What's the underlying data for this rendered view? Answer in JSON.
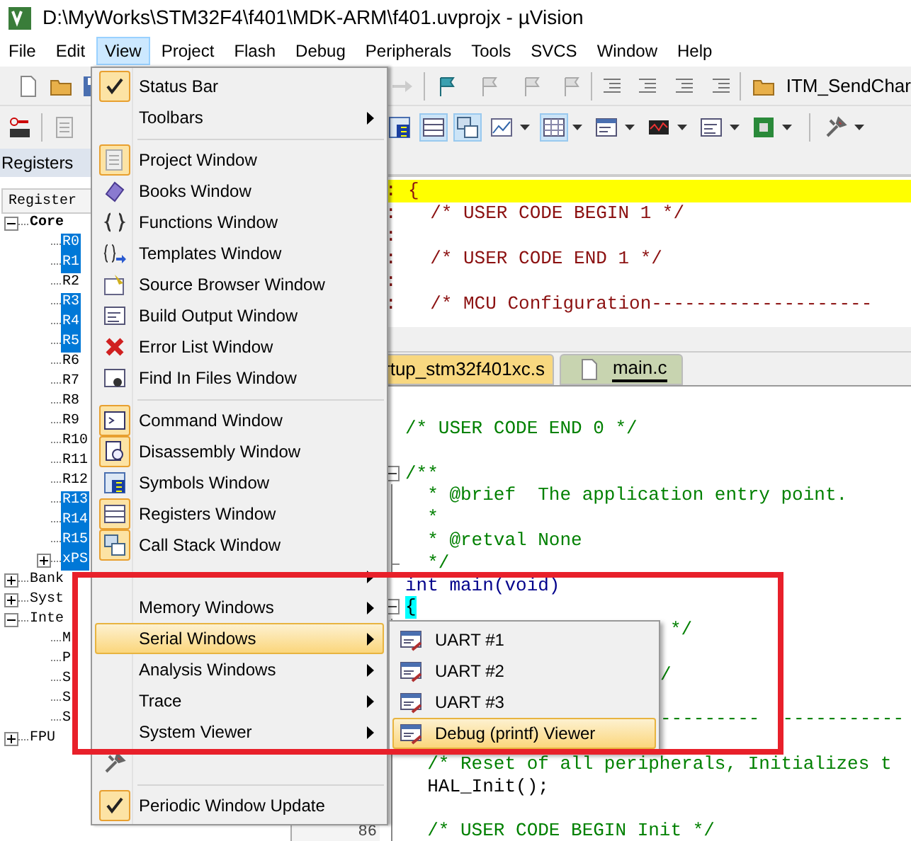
{
  "window": {
    "title": "D:\\MyWorks\\STM32F4\\f401\\MDK-ARM\\f401.uvprojx - µVision"
  },
  "menu_bar": [
    {
      "label": "File",
      "selected": false
    },
    {
      "label": "Edit",
      "selected": false
    },
    {
      "label": "View",
      "selected": true
    },
    {
      "label": "Project",
      "selected": false
    },
    {
      "label": "Flash",
      "selected": false
    },
    {
      "label": "Debug",
      "selected": false
    },
    {
      "label": "Peripherals",
      "selected": false
    },
    {
      "label": "Tools",
      "selected": false
    },
    {
      "label": "SVCS",
      "selected": false
    },
    {
      "label": "Window",
      "selected": false
    },
    {
      "label": "Help",
      "selected": false
    }
  ],
  "toolbar_1": {
    "function_label": "ITM_SendChar"
  },
  "toolbar_2": [
    {
      "on": false
    },
    {
      "on": true
    },
    {
      "on": true
    },
    {
      "on": false
    },
    {
      "on": true
    },
    {
      "on": false
    },
    {
      "on": false
    },
    {
      "on": false
    },
    {
      "on": false
    },
    {
      "on": false
    }
  ],
  "registers_panel": {
    "title": "Registers",
    "column": "Register",
    "tree": [
      {
        "label": "Core",
        "expanded": true,
        "selected": false,
        "children": [
          {
            "label": "R0",
            "selected": true
          },
          {
            "label": "R1",
            "selected": true
          },
          {
            "label": "R2",
            "selected": false
          },
          {
            "label": "R3",
            "selected": true
          },
          {
            "label": "R4",
            "selected": true
          },
          {
            "label": "R5",
            "selected": true
          },
          {
            "label": "R6",
            "selected": false
          },
          {
            "label": "R7",
            "selected": false
          },
          {
            "label": "R8",
            "selected": false
          },
          {
            "label": "R9",
            "selected": false
          },
          {
            "label": "R10",
            "selected": false
          },
          {
            "label": "R11",
            "selected": false
          },
          {
            "label": "R12",
            "selected": false
          },
          {
            "label": "R13",
            "selected": true
          },
          {
            "label": "R14",
            "selected": true
          },
          {
            "label": "R15",
            "selected": true
          },
          {
            "label": "xPS",
            "selected": true,
            "expanded": false
          }
        ]
      },
      {
        "label": "Bank",
        "expanded": false,
        "selected": false
      },
      {
        "label": "Syst",
        "expanded": false,
        "selected": false
      },
      {
        "label": "Inte",
        "expanded": true,
        "selected": false,
        "children": [
          {
            "label": "M",
            "selected": false
          },
          {
            "label": "P",
            "selected": false
          },
          {
            "label": "S",
            "selected": false
          },
          {
            "label": "S",
            "selected": false
          },
          {
            "label": "S",
            "selected": false
          }
        ]
      },
      {
        "label": "FPU",
        "expanded": false,
        "selected": false
      }
    ]
  },
  "disassembly": {
    "lines": [
      {
        "marker": ":",
        "text": "{",
        "current": true
      },
      {
        "marker": ":",
        "text": "  /* USER CODE BEGIN 1 */",
        "current": false
      },
      {
        "marker": ":",
        "current": false
      },
      {
        "marker": ":",
        "text": "  /* USER CODE END 1 */",
        "current": false
      },
      {
        "marker": ":",
        "current": false
      },
      {
        "marker": ":",
        "text": "  /* MCU Configuration--------------------",
        "current": false
      }
    ]
  },
  "file_tabs": [
    {
      "label": "rtup_stm32f401xc.s",
      "selected": false
    },
    {
      "label": "main.c",
      "selected": true
    }
  ],
  "editor": {
    "lines": [
      {
        "kind": "comment",
        "text": "/* USER CODE END 0 */"
      },
      {
        "kind": "blank"
      },
      {
        "kind": "comment",
        "text": "/**",
        "expanded": true,
        "children": [
          {
            "kind": "comment",
            "text": "  * @brief  The application entry point."
          },
          {
            "kind": "comment",
            "text": "  *"
          },
          {
            "kind": "comment",
            "text": "  * @retval None"
          },
          {
            "kind": "comment",
            "text": "  */"
          }
        ]
      },
      {
        "kind": "keyword",
        "text": "int main(void)"
      },
      {
        "kind": "brace",
        "text": "{",
        "expanded": true,
        "children": [
          {
            "kind": "tail",
            "text": "*/"
          },
          {
            "kind": "blank"
          },
          {
            "kind": "tail",
            "text": "/"
          },
          {
            "kind": "blank"
          },
          {
            "kind": "tail",
            "parts": [
              "---------",
              "-----------"
            ]
          },
          {
            "kind": "blank"
          },
          {
            "kind": "comment",
            "text": "  /* Reset of all peripherals, Initializes t"
          },
          {
            "kind": "code",
            "text": "  HAL_Init();"
          },
          {
            "kind": "blank"
          },
          {
            "kind": "comment",
            "text": "  /* USER CODE BEGIN Init */",
            "number": "86"
          }
        ]
      }
    ]
  },
  "view_menu": {
    "items": [
      {
        "kind": "item",
        "label": "Status Bar",
        "checked": true,
        "selected": false
      },
      {
        "kind": "submenu",
        "label": "Toolbars",
        "selected": false
      },
      {
        "kind": "separator"
      },
      {
        "kind": "item",
        "label": "Project Window",
        "checked": true,
        "selected": false
      },
      {
        "kind": "item",
        "label": "Books Window",
        "checked": false,
        "selected": false
      },
      {
        "kind": "item",
        "label": "Functions Window",
        "checked": false,
        "selected": false
      },
      {
        "kind": "item",
        "label": "Templates Window",
        "checked": false,
        "selected": false
      },
      {
        "kind": "item",
        "label": "Source Browser Window",
        "checked": false,
        "selected": false
      },
      {
        "kind": "item",
        "label": "Build Output Window",
        "checked": false,
        "selected": false
      },
      {
        "kind": "item",
        "label": "Error List Window",
        "checked": false,
        "selected": false
      },
      {
        "kind": "item",
        "label": "Find In Files Window",
        "checked": false,
        "selected": false
      },
      {
        "kind": "separator"
      },
      {
        "kind": "item",
        "label": "Command Window",
        "checked": true,
        "selected": false
      },
      {
        "kind": "item",
        "label": "Disassembly Window",
        "checked": true,
        "selected": false
      },
      {
        "kind": "item",
        "label": "Symbols Window",
        "checked": false,
        "selected": false
      },
      {
        "kind": "item",
        "label": "Registers Window",
        "checked": true,
        "selected": false
      },
      {
        "kind": "item",
        "label": "Call Stack Window",
        "checked": true,
        "selected": false
      },
      {
        "kind": "submenu",
        "selected": false
      },
      {
        "kind": "submenu",
        "label": "Memory Windows",
        "selected": false
      },
      {
        "kind": "submenu",
        "label": "Serial Windows",
        "selected": true
      },
      {
        "kind": "submenu",
        "label": "Analysis Windows",
        "selected": false
      },
      {
        "kind": "submenu",
        "label": "Trace",
        "selected": false
      },
      {
        "kind": "submenu",
        "label": "System Viewer",
        "selected": false
      },
      {
        "kind": "item",
        "checked": false,
        "selected": false
      },
      {
        "kind": "separator"
      },
      {
        "kind": "item",
        "label": "Periodic Window Update",
        "checked": true,
        "selected": false
      }
    ]
  },
  "serial_submenu": {
    "items": [
      {
        "label": "UART #1",
        "selected": false
      },
      {
        "label": "UART #2",
        "selected": false
      },
      {
        "label": "UART #3",
        "selected": false
      },
      {
        "label": "Debug (printf) Viewer",
        "selected": true
      }
    ]
  }
}
